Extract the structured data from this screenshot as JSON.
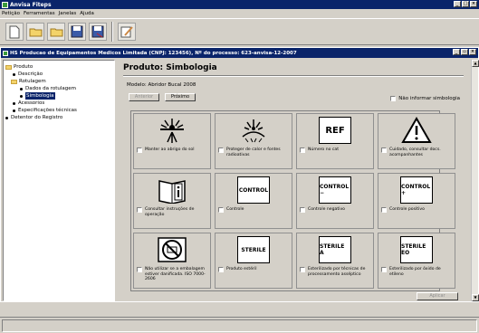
{
  "app": {
    "title": "Anvisa Fiteps",
    "menu": [
      "Petição",
      "Ferramentas",
      "Janelas",
      "Ajuda"
    ]
  },
  "toolbar": {
    "icons": [
      "new-document-icon",
      "open-folder-icon",
      "open-folder-icon",
      "save-icon",
      "save-all-icon",
      "edit-icon"
    ]
  },
  "child_window": {
    "title": "HS Producao de Equipamentos Medicos Limitada (CNPJ: 123456), Nº do processo: 623-anvisa-12-2007"
  },
  "tree": {
    "root": "Produto",
    "descricao": "Descrição",
    "rotulagem": "Rotulagem",
    "dados": "Dados da rotulagem",
    "simbologia": "Simbologia",
    "acessorios": "Acessorios",
    "especificacoes": "Especificações técnicas",
    "detentor": "Detentor do Registro"
  },
  "panel": {
    "title": "Produto: Simbologia",
    "modelo": "Modelo: Abridor Bucal 2008",
    "anterior": "Anterior",
    "proximo": "Próximo",
    "nao_informar": "Não informar simbologia",
    "aplicar": "Aplicar"
  },
  "symbols": [
    {
      "icon": "sun-icon",
      "label": "Manter ao abrigo do sol"
    },
    {
      "icon": "heat-radiation-icon",
      "label": "Proteger de calor e fontes radioativas"
    },
    {
      "text": "REF",
      "label": "Número no cat"
    },
    {
      "icon": "warning-triangle-icon",
      "label": "Cuidado, consultar docs. acompanhantes"
    },
    {
      "icon": "instructions-book-icon",
      "label": "Consultar instruções de operação"
    },
    {
      "text": "CONTROL",
      "label": "Controle"
    },
    {
      "text": "CONTROL −",
      "label": "Controle negativo"
    },
    {
      "text": "CONTROL +",
      "label": "Controle positivo"
    },
    {
      "icon": "no-damaged-package-icon",
      "label": "Não utilizar se a embalagem estiver danificada. ISO 7000-2606"
    },
    {
      "text": "STERILE",
      "label": "Produto estéril"
    },
    {
      "text": "STERILE A",
      "label": "Esterilizado por técnicas de processamento asséptico"
    },
    {
      "text": "STERILE EO",
      "label": "Esterilizado por óxido de etileno"
    }
  ]
}
